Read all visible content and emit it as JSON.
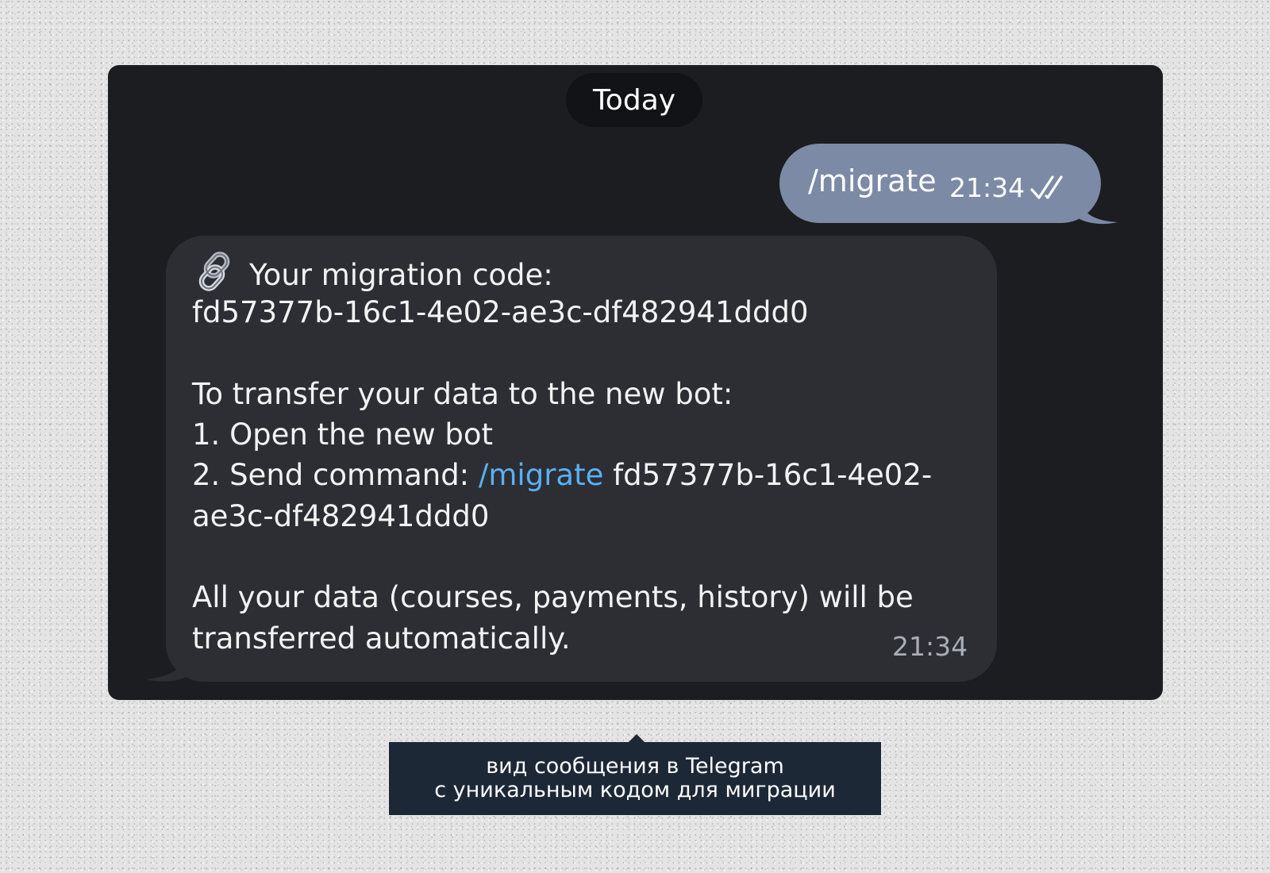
{
  "chat": {
    "date_divider": "Today",
    "outgoing": {
      "text": "/migrate",
      "time": "21:34",
      "status_icon": "double-check-icon"
    },
    "incoming": {
      "link_icon": "link-icon",
      "line_1": "Your migration code:",
      "line_2": "fd57377b-16c1-4e02-ae3c-df482941ddd0",
      "line_3": "To transfer your data to the new bot:",
      "line_4": "1. Open the new bot",
      "line_5_prefix": "2. Send command: ",
      "line_5_command": "/migrate",
      "line_5_suffix": " fd57377b-16c1-4e02-",
      "line_6": "ae3c-df482941ddd0",
      "line_7": "All your data (courses, payments, history) will be",
      "line_8": "transferred automatically.",
      "time": "21:34"
    }
  },
  "caption": {
    "line_1": "вид сообщения в Telegram",
    "line_2": "с уникальным кодом для миграции"
  },
  "colors": {
    "window_bg": "#1c1d21",
    "outgoing_bubble": "#7c8aa6",
    "incoming_bubble": "#2c2e34",
    "command_link": "#5ab0f0",
    "caption_bg": "#1d2837"
  }
}
